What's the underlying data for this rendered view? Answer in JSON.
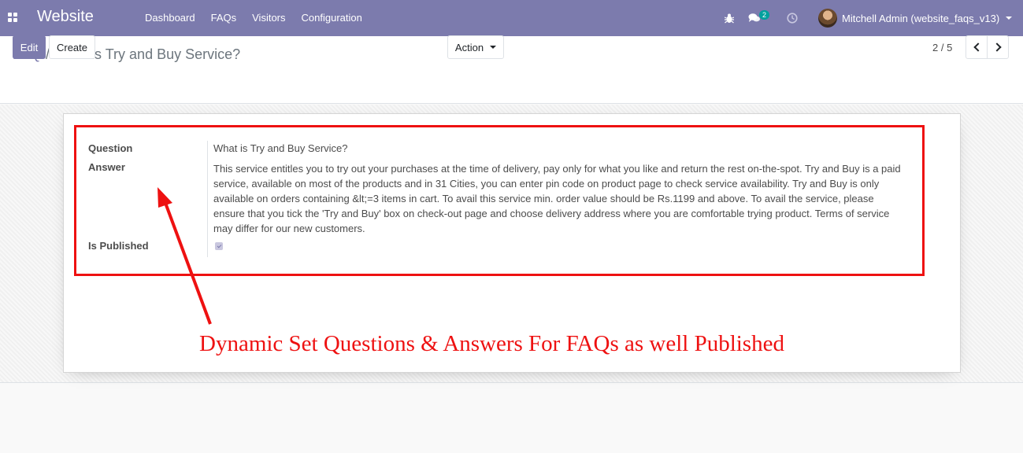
{
  "navbar": {
    "apps_icon": "apps-grid-icon",
    "brand": "Website",
    "menu": [
      "Dashboard",
      "FAQs",
      "Visitors",
      "Configuration"
    ],
    "chat_badge": "2",
    "user_name": "Mitchell Admin (website_faqs_v13)"
  },
  "control_panel": {
    "breadcrumb_parent": "FAQ",
    "breadcrumb_separator": "/",
    "breadcrumb_current": "What is Try and Buy Service?",
    "edit_label": "Edit",
    "create_label": "Create",
    "action_label": "Action",
    "pager": "2 / 5"
  },
  "form": {
    "question_label": "Question",
    "question_value": "What is Try and Buy Service?",
    "answer_label": "Answer",
    "answer_value": "This service entitles you to try out your purchases at the time of delivery, pay only for what you like and return the rest on-the-spot. Try and Buy is a paid service, available on most of the products and in 31 Cities, you can enter pin code on product page to check service availability. Try and Buy is only available on orders containing &lt;=3 items in cart. To avail this service min. order value should be Rs.1199 and above. To avail the service, please ensure that you tick the 'Try and Buy' box on check-out page and choose delivery address where you are comfortable trying product. Terms of service may differ for our new customers.",
    "published_label": "Is Published",
    "published": true
  },
  "annotation": {
    "text": "Dynamic Set Questions & Answers For FAQs as well Published",
    "color": "#ee1111"
  },
  "colors": {
    "navbar": "#7c7bad",
    "primary": "#7c7bad",
    "badge": "#00a09d"
  }
}
